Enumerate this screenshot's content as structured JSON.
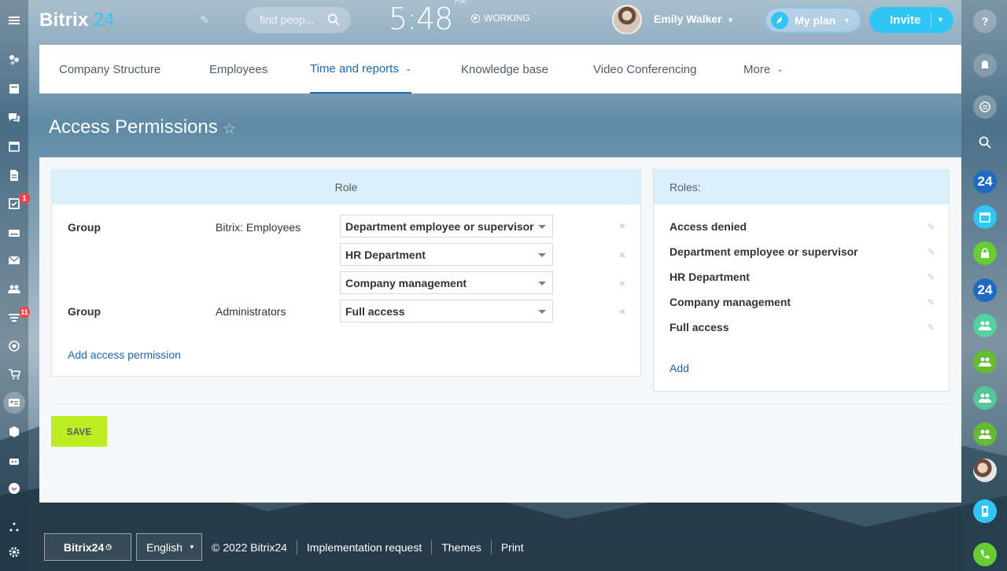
{
  "app": {
    "logo_text": "Bitrix",
    "logo_suffix": "24"
  },
  "header": {
    "search_placeholder": "find peop...",
    "clock": "5:48",
    "clock_ampm": "PM",
    "status": "WORKING",
    "user_name": "Emily Walker",
    "myplan_label": "My plan",
    "invite_label": "Invite"
  },
  "left_nav": {
    "badges": {
      "tasks": "1",
      "feed": "11"
    }
  },
  "nav": {
    "items": [
      {
        "label": "Company Structure"
      },
      {
        "label": "Employees"
      },
      {
        "label": "Time and reports"
      },
      {
        "label": "Knowledge base"
      },
      {
        "label": "Video Conferencing"
      },
      {
        "label": "More"
      }
    ]
  },
  "page": {
    "title": "Access Permissions"
  },
  "permissions": {
    "header": "Role",
    "rows": [
      {
        "type": "Group",
        "group": "Bitrix: Employees"
      },
      {
        "type": "Group",
        "group": "Administrators"
      }
    ],
    "selects": [
      "Department employee or supervisor",
      "HR Department",
      "Company management",
      "Full access"
    ],
    "add_label": "Add access permission"
  },
  "roles": {
    "header": "Roles:",
    "items": [
      "Access denied",
      "Department employee or supervisor",
      "HR Department",
      "Company management",
      "Full access"
    ],
    "add_label": "Add"
  },
  "save_label": "SAVE",
  "footer": {
    "logo": "Bitrix24",
    "language": "English",
    "copyright": "© 2022 Bitrix24",
    "links": [
      "Implementation request",
      "Themes",
      "Print"
    ]
  },
  "right_rail": {
    "bitrix_badge": "24"
  },
  "colors": {
    "accent": "#2fc6f6",
    "link": "#2067b0",
    "save": "#bbed21",
    "green": "#55d0a0"
  }
}
